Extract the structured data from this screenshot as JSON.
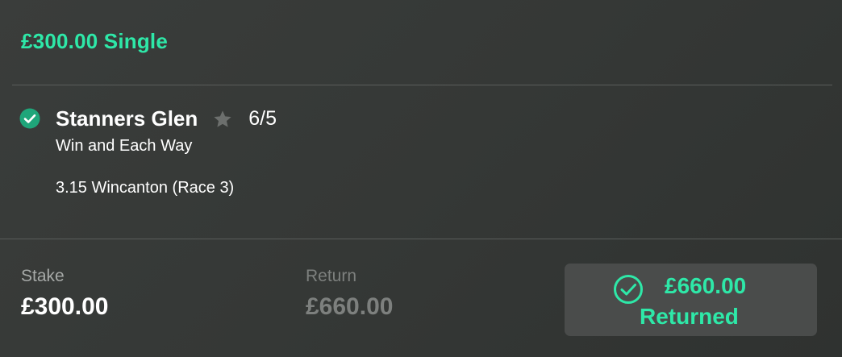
{
  "bet": {
    "title": "£300.00 Single"
  },
  "selection": {
    "status_icon": "check-circle-icon",
    "name": "Stanners Glen",
    "favourite_icon": "star-icon",
    "odds": "6/5",
    "market": "Win and Each Way",
    "event": "3.15 Wincanton (Race 3)"
  },
  "summary": {
    "stake_label": "Stake",
    "stake_value": "£300.00",
    "return_label": "Return",
    "return_value": "£660.00"
  },
  "result": {
    "icon": "check-circle-outline-icon",
    "amount": "£660.00",
    "label": "Returned"
  },
  "colors": {
    "accent": "#2ee8a8",
    "check_fill": "#1fa67a",
    "star": "#6c6f6d",
    "muted": "#7d807e",
    "result_box": "#4a4c4b"
  }
}
